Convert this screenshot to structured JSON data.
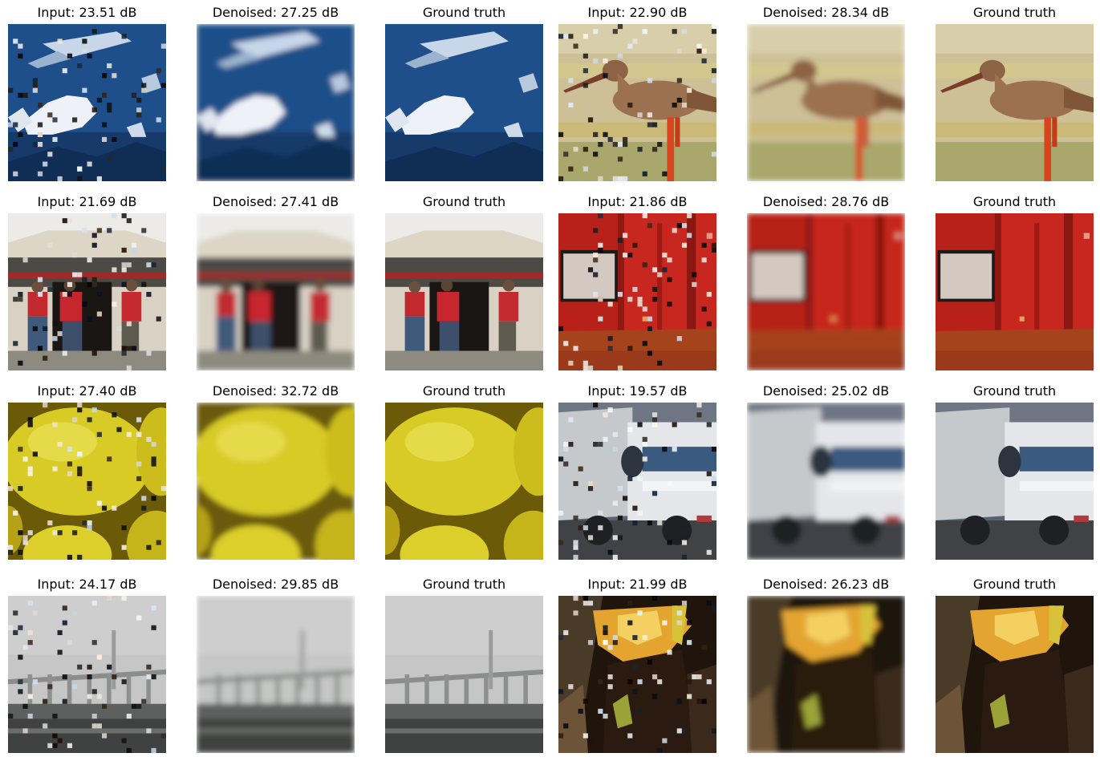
{
  "rows": [
    {
      "cells": [
        {
          "caption": "Input: 23.51 dB",
          "scene": "mountain",
          "variant": "input"
        },
        {
          "caption": "Denoised: 27.25 dB",
          "scene": "mountain",
          "variant": "denoised"
        },
        {
          "caption": "Ground truth",
          "scene": "mountain",
          "variant": "truth"
        },
        {
          "caption": "Input: 22.90 dB",
          "scene": "bird",
          "variant": "input"
        },
        {
          "caption": "Denoised: 28.34 dB",
          "scene": "bird",
          "variant": "denoised"
        },
        {
          "caption": "Ground truth",
          "scene": "bird",
          "variant": "truth"
        }
      ]
    },
    {
      "cells": [
        {
          "caption": "Input: 21.69 dB",
          "scene": "yurt",
          "variant": "input"
        },
        {
          "caption": "Denoised: 27.41 dB",
          "scene": "yurt",
          "variant": "denoised"
        },
        {
          "caption": "Ground truth",
          "scene": "yurt",
          "variant": "truth"
        },
        {
          "caption": "Input: 21.86 dB",
          "scene": "redroom",
          "variant": "input"
        },
        {
          "caption": "Denoised: 28.76 dB",
          "scene": "redroom",
          "variant": "denoised"
        },
        {
          "caption": "Ground truth",
          "scene": "redroom",
          "variant": "truth"
        }
      ]
    },
    {
      "cells": [
        {
          "caption": "Input: 27.40 dB",
          "scene": "lemons",
          "variant": "input"
        },
        {
          "caption": "Denoised: 32.72 dB",
          "scene": "lemons",
          "variant": "denoised"
        },
        {
          "caption": "Ground truth",
          "scene": "lemons",
          "variant": "truth"
        },
        {
          "caption": "Input: 19.57 dB",
          "scene": "truck",
          "variant": "input"
        },
        {
          "caption": "Denoised: 25.02 dB",
          "scene": "truck",
          "variant": "denoised"
        },
        {
          "caption": "Ground truth",
          "scene": "truck",
          "variant": "truth"
        }
      ]
    },
    {
      "cells": [
        {
          "caption": "Input: 24.17 dB",
          "scene": "bridge",
          "variant": "input"
        },
        {
          "caption": "Denoised: 29.85 dB",
          "scene": "bridge",
          "variant": "denoised"
        },
        {
          "caption": "Ground truth",
          "scene": "bridge",
          "variant": "truth"
        },
        {
          "caption": "Input: 21.99 dB",
          "scene": "dark",
          "variant": "input"
        },
        {
          "caption": "Denoised: 26.23 dB",
          "scene": "dark",
          "variant": "denoised"
        },
        {
          "caption": "Ground truth",
          "scene": "dark",
          "variant": "truth"
        }
      ]
    }
  ]
}
